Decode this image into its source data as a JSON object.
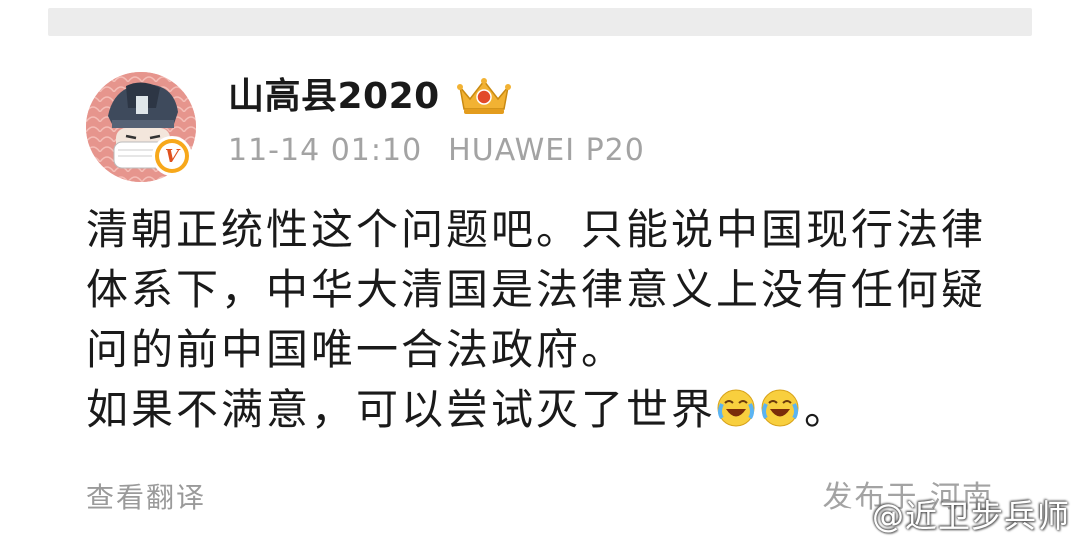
{
  "post": {
    "author": "山高县2020",
    "verified_badge": "V",
    "timestamp": "11-14 01:10",
    "device": "HUAWEI P20",
    "lines": [
      "清朝正统性这个问题吧。只能说中国现行法律体系下，中华大清国是法律意义上没有任何疑问的前中国唯一合法政府。",
      "如果不满意，可以尝试灭了世界"
    ],
    "line_end": "。",
    "translate_link": "查看翻译",
    "location": "发布于 河南"
  },
  "watermark": "@近卫步兵师",
  "icons": {
    "avatar": "cartoon-avatar",
    "badge": "verified-badge-icon",
    "crown": "crown-icon",
    "emoji": "laughing-crying-emoji",
    "watermark_logo": "weibo-logo-icon"
  },
  "colors": {
    "text": "#1a1a1a",
    "meta": "#a3a3a3",
    "badge_bg": "#f7a81b",
    "badge_letter": "#e0521f",
    "crown": "#f2b233"
  }
}
